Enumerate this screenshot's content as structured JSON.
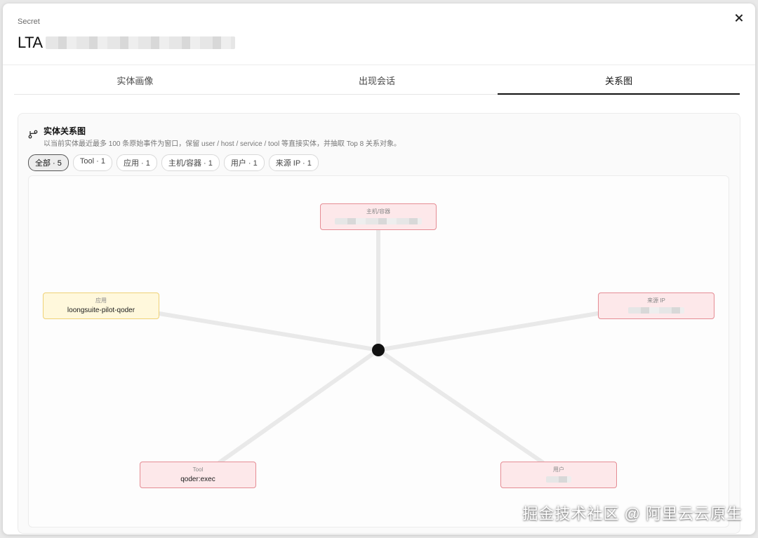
{
  "header": {
    "kind_label": "Secret",
    "title": "LTA",
    "close_label": "×"
  },
  "tabs": [
    {
      "label": "实体画像",
      "active": false
    },
    {
      "label": "出现会话",
      "active": false
    },
    {
      "label": "关系图",
      "active": true
    }
  ],
  "card": {
    "title": "实体关系图",
    "description": "以当前实体最近最多 100 条原始事件为窗口，保留 user / host / service / tool 等直接实体，并抽取 Top 8 关系对象。"
  },
  "filters": [
    {
      "label": "全部 · 5",
      "active": true
    },
    {
      "label": "Tool · 1",
      "active": false
    },
    {
      "label": "应用 · 1",
      "active": false
    },
    {
      "label": "主机/容器 · 1",
      "active": false
    },
    {
      "label": "用户 · 1",
      "active": false
    },
    {
      "label": "来源 IP · 1",
      "active": false
    }
  ],
  "graph": {
    "nodes": [
      {
        "type": "主机/容器",
        "value": "",
        "style": "red"
      },
      {
        "type": "应用",
        "value": "loongsuite-pilot-qoder",
        "style": "yellow"
      },
      {
        "type": "来源 IP",
        "value": "",
        "style": "red"
      },
      {
        "type": "Tool",
        "value": "qoder:exec",
        "style": "red"
      },
      {
        "type": "用户",
        "value": "",
        "style": "red"
      }
    ],
    "colors": {
      "edge": "#e9e9e9",
      "center": "#111111",
      "red_fill": "#fde8ea",
      "red_border": "#e58c94",
      "yellow_fill": "#fff8dc",
      "yellow_border": "#efd177"
    }
  },
  "watermark": "掘金技术社区 @ 阿里云云原生"
}
